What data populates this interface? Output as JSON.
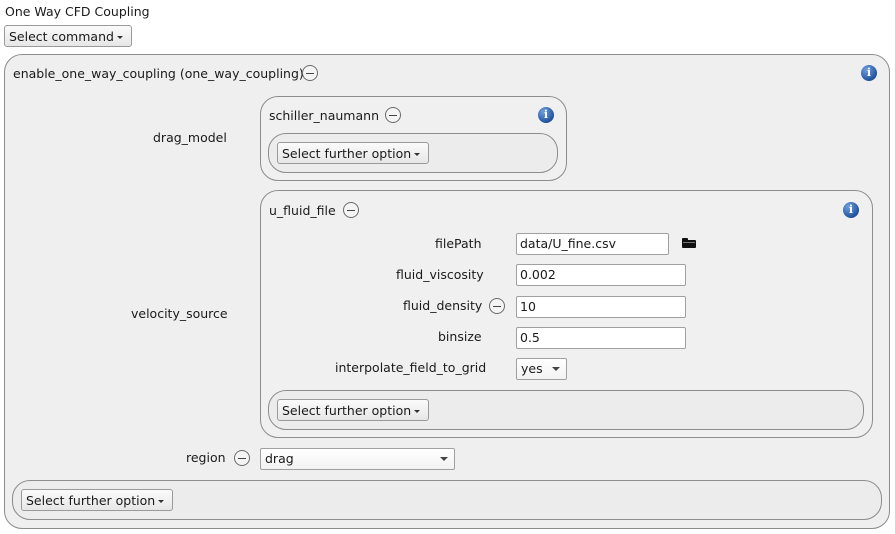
{
  "window": {
    "title": "One Way CFD Coupling"
  },
  "toolbar": {
    "select_command": "Select command"
  },
  "main_panel": {
    "title": "enable_one_way_coupling (one_way_coupling)",
    "further_option": "Select further option"
  },
  "drag_model": {
    "label": "drag_model",
    "panel_title": "schiller_naumann",
    "further_option": "Select further option"
  },
  "velocity_source": {
    "label": "velocity_source",
    "panel_title": "u_fluid_file",
    "fields": {
      "filepath_label": "filePath",
      "filepath_value": "data/U_fine.csv",
      "viscosity_label": "fluid_viscosity",
      "viscosity_value": "0.002",
      "density_label": "fluid_density",
      "density_value": "10",
      "binsize_label": "binsize",
      "binsize_value": "0.5",
      "interpolate_label": "interpolate_field_to_grid",
      "interpolate_value": "yes"
    },
    "further_option": "Select further option"
  },
  "region": {
    "label": "region",
    "value": "drag"
  },
  "icons": {
    "info": "info-icon",
    "remove": "minus-circle-icon",
    "browse": "folder-icon",
    "info_glyph": "i"
  }
}
